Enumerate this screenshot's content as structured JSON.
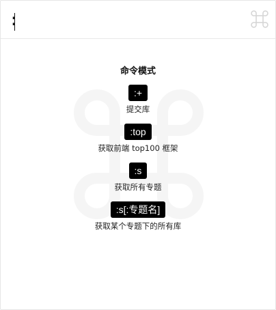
{
  "search": {
    "value": ":",
    "shortcut_icon": "command-key-icon"
  },
  "help": {
    "title": "命令模式",
    "commands": [
      {
        "key": ":+",
        "description": "提交库"
      },
      {
        "key": ":top",
        "description": "获取前端 top100 框架"
      },
      {
        "key": ":s",
        "description": "获取所有专题"
      },
      {
        "key": ":s[:专题名]",
        "description": "获取某个专题下的所有库"
      }
    ]
  },
  "colors": {
    "key_background": "#000000",
    "key_text": "#ffffff",
    "watermark": "#f5f5f5",
    "shortcut_glyph": "#d6d6d6"
  }
}
